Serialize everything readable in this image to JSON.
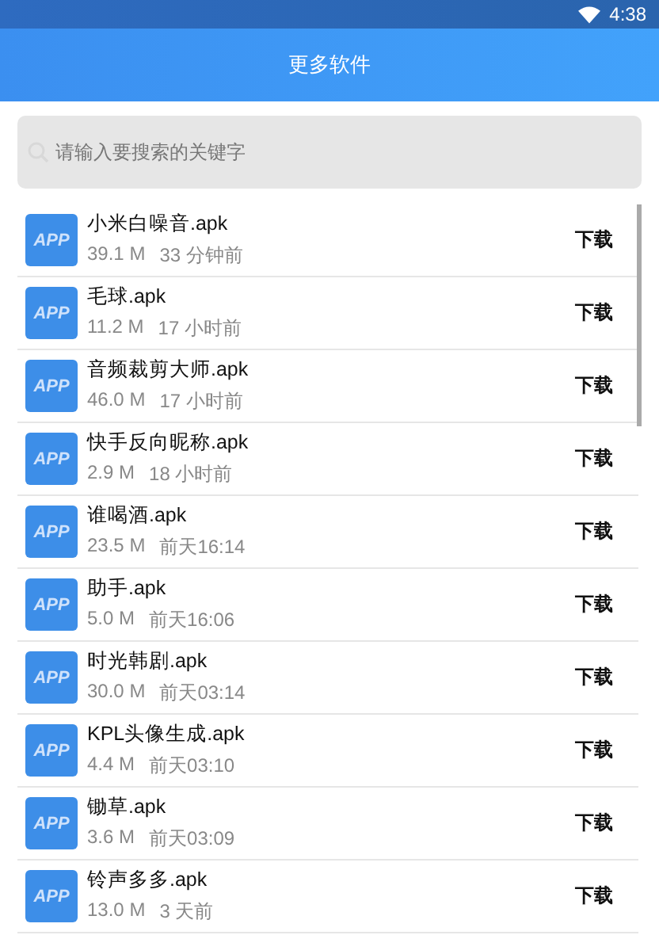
{
  "status_bar": {
    "time": "4:38"
  },
  "header": {
    "title": "更多软件"
  },
  "search": {
    "placeholder": "请输入要搜索的关键字"
  },
  "apps": [
    {
      "icon_label": "APP",
      "name": "小米白噪音.apk",
      "size": "39.1 M",
      "time": "33 分钟前",
      "action": "下载"
    },
    {
      "icon_label": "APP",
      "name": "毛球.apk",
      "size": "11.2 M",
      "time": "17 小时前",
      "action": "下载"
    },
    {
      "icon_label": "APP",
      "name": "音频裁剪大师.apk",
      "size": "46.0 M",
      "time": "17 小时前",
      "action": "下载"
    },
    {
      "icon_label": "APP",
      "name": "快手反向昵称.apk",
      "size": "2.9 M",
      "time": "18 小时前",
      "action": "下载"
    },
    {
      "icon_label": "APP",
      "name": "谁喝酒.apk",
      "size": "23.5 M",
      "time": "前天16:14",
      "action": "下载"
    },
    {
      "icon_label": "APP",
      "name": "助手.apk",
      "size": "5.0 M",
      "time": "前天16:06",
      "action": "下载"
    },
    {
      "icon_label": "APP",
      "name": "时光韩剧.apk",
      "size": "30.0 M",
      "time": "前天03:14",
      "action": "下载"
    },
    {
      "icon_label": "APP",
      "name": "KPL头像生成.apk",
      "size": "4.4 M",
      "time": "前天03:10",
      "action": "下载"
    },
    {
      "icon_label": "APP",
      "name": "锄草.apk",
      "size": "3.6 M",
      "time": "前天03:09",
      "action": "下载"
    },
    {
      "icon_label": "APP",
      "name": "铃声多多.apk",
      "size": "13.0 M",
      "time": "3 天前",
      "action": "下载"
    }
  ]
}
